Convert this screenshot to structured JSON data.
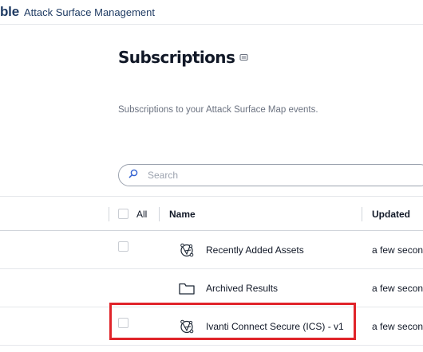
{
  "header": {
    "brand": "ble",
    "product": "Attack Surface Management"
  },
  "page": {
    "title": "Subscriptions",
    "subtitle": "Subscriptions to your Attack Surface Map events."
  },
  "search": {
    "placeholder": "Search",
    "value": ""
  },
  "table": {
    "columns": {
      "all": "All",
      "name": "Name",
      "updated": "Updated"
    },
    "rows": [
      {
        "icon": "subscription-map-icon",
        "name": "Recently Added Assets",
        "updated": "a few secon"
      },
      {
        "icon": "folder-icon",
        "name": "Archived Results",
        "updated": "a few secon"
      },
      {
        "icon": "subscription-map-icon",
        "name": "Ivanti Connect Secure (ICS) - v1",
        "updated": "a few secon"
      }
    ]
  },
  "colors": {
    "brand": "#1f3b63",
    "highlight": "#e0242a",
    "search_icon": "#2f5fd0"
  }
}
